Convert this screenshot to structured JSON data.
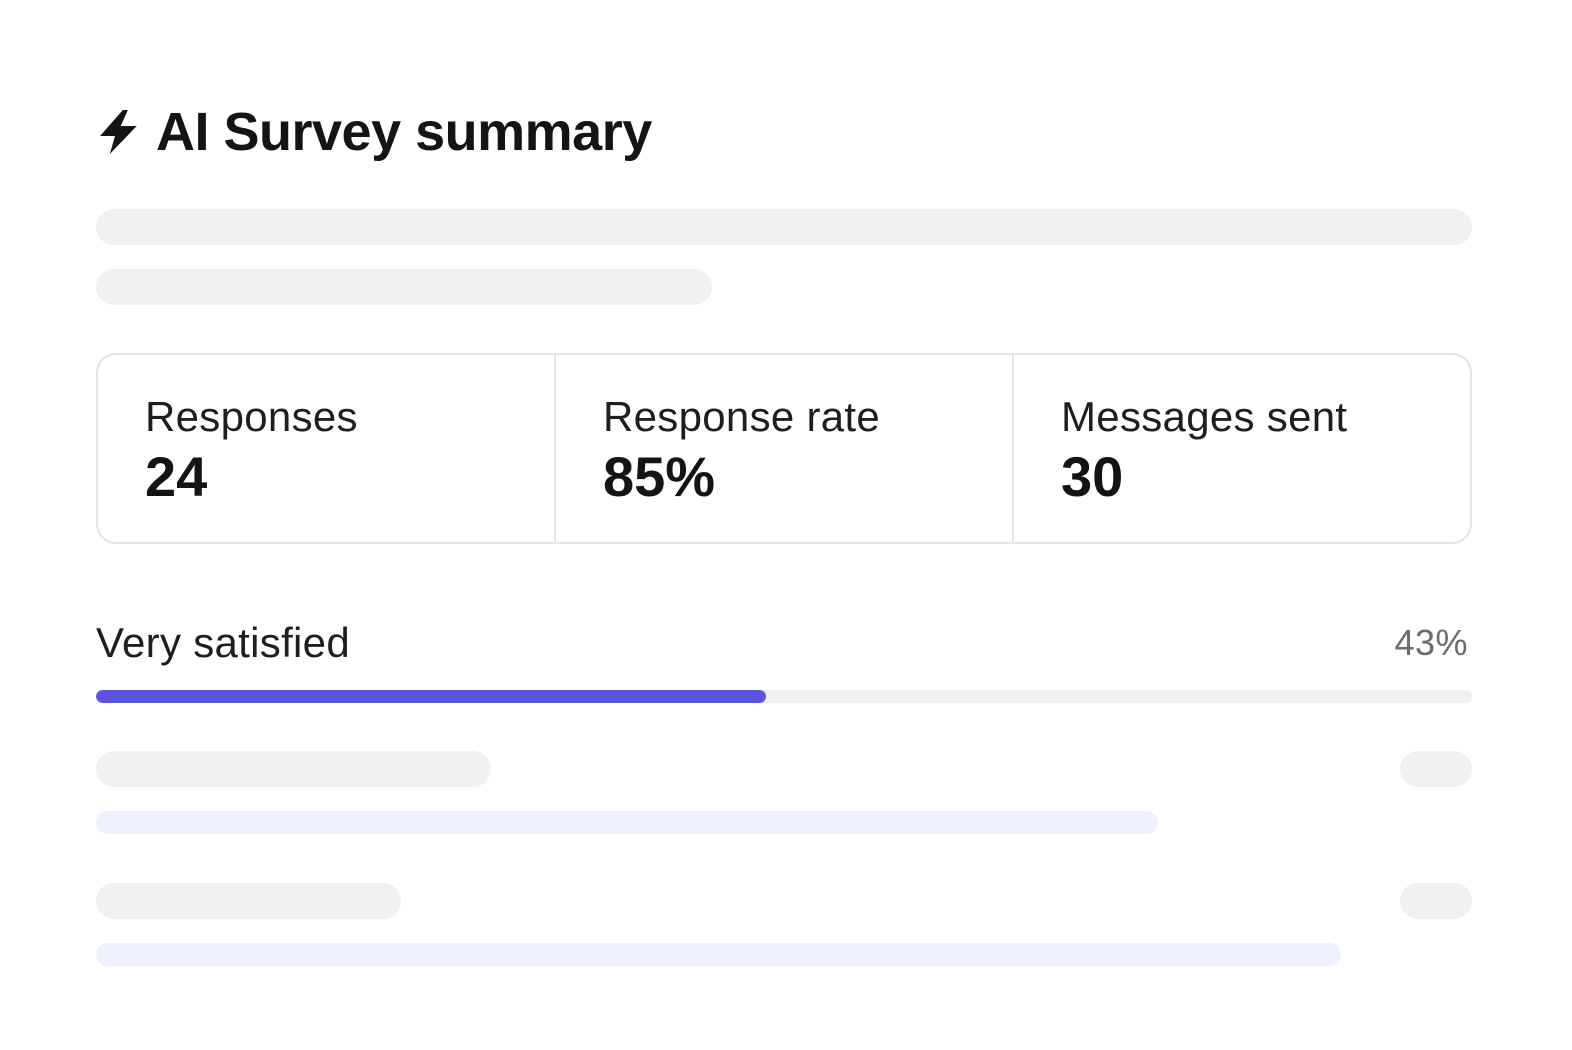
{
  "header": {
    "icon": "lightning-bolt-icon",
    "title": "AI Survey summary"
  },
  "stats": [
    {
      "label": "Responses",
      "value": "24"
    },
    {
      "label": "Response rate",
      "value": "85%"
    },
    {
      "label": "Messages sent",
      "value": "30"
    }
  ],
  "results": {
    "primary": {
      "label": "Very satisfied",
      "percent_text": "43%",
      "fraction": 0.487
    }
  },
  "colors": {
    "accent": "#5b54e0",
    "skeleton": "#f0f0f0",
    "skeleton_bar": "#eef1fd",
    "border": "#e4e4e4"
  }
}
